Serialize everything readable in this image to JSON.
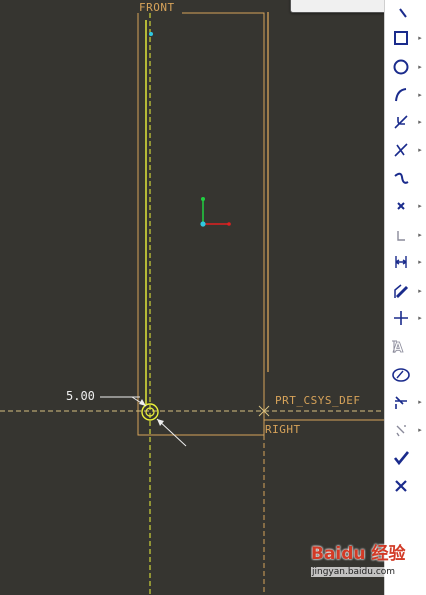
{
  "canvas": {
    "labels": {
      "front": "FRONT",
      "csys": "PRT_CSYS_DEF",
      "right": "RIGHT",
      "dimension": "5.00"
    },
    "colors": {
      "background": "#363530",
      "datum": "#d7a35a",
      "sketch": "#ecf23a",
      "csys_x": "#e02020",
      "csys_y": "#20d040",
      "csys_origin": "#30c8e0",
      "dimension": "#eeeeee"
    }
  },
  "toolbar": {
    "icon_color": "#1a2b8c",
    "buttons": [
      {
        "name": "select-icon",
        "flyout": false
      },
      {
        "name": "rectangle-icon",
        "flyout": true
      },
      {
        "name": "circle-icon",
        "flyout": true
      },
      {
        "name": "arc-icon",
        "flyout": true
      },
      {
        "name": "fillet-icon",
        "flyout": true
      },
      {
        "name": "chamfer-icon",
        "flyout": true
      },
      {
        "name": "spline-icon",
        "flyout": false
      },
      {
        "name": "point-icon",
        "flyout": true
      },
      {
        "name": "offset-edge-icon",
        "flyout": true
      },
      {
        "name": "dimension-icon",
        "flyout": true
      },
      {
        "name": "modify-icon",
        "flyout": true
      },
      {
        "name": "constraint-icon",
        "flyout": true
      },
      {
        "name": "text-icon",
        "flyout": false
      },
      {
        "name": "palette-icon",
        "flyout": false
      },
      {
        "name": "trim-icon",
        "flyout": true
      },
      {
        "name": "mirror-icon",
        "flyout": true
      },
      {
        "name": "accept-icon",
        "flyout": false
      },
      {
        "name": "cancel-icon",
        "flyout": false
      }
    ]
  },
  "watermark": {
    "brand": "Baidu 经验",
    "url": "jingyan.baidu.com"
  }
}
